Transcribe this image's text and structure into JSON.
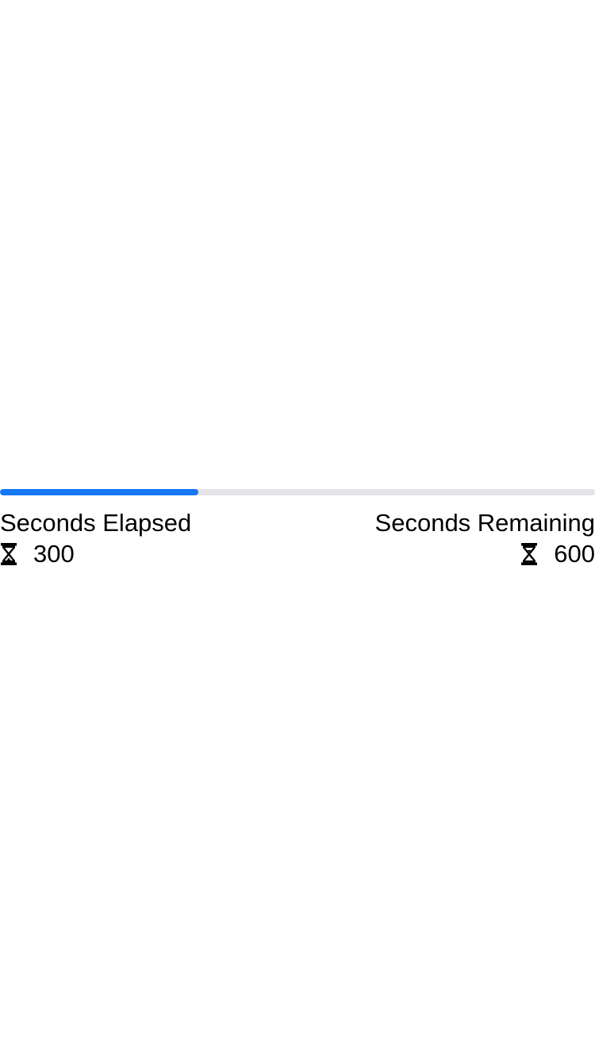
{
  "timer": {
    "progress_fraction": 0.3333,
    "elapsed_label": "Seconds Elapsed",
    "elapsed_value": "300",
    "remaining_label": "Seconds Remaining",
    "remaining_value": "600",
    "elapsed_icon": "hourglass-top-icon",
    "remaining_icon": "hourglass-bottom-icon"
  },
  "colors": {
    "progress_fill": "#1677f2",
    "progress_track": "#e3e3e8",
    "text": "#000000",
    "background": "#ffffff"
  }
}
